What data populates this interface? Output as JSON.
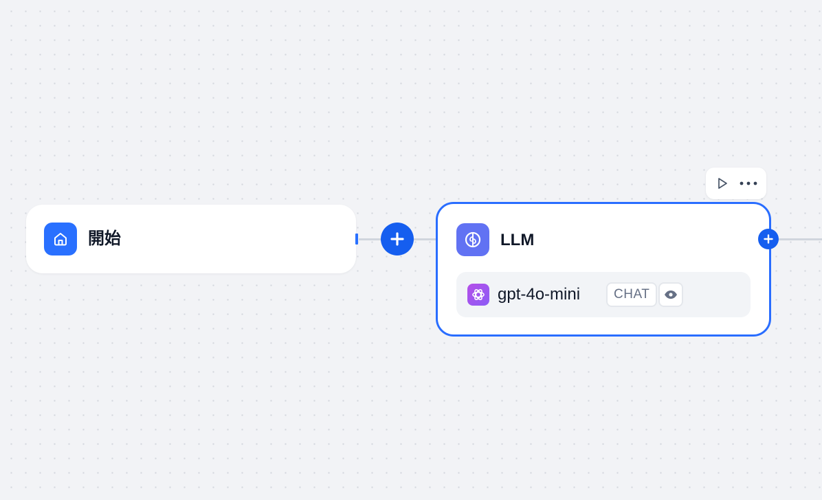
{
  "workflow": {
    "nodes": [
      {
        "id": "start",
        "title": "開始",
        "icon": "home-icon",
        "icon_color": "#2970ff"
      },
      {
        "id": "llm",
        "title": "LLM",
        "icon": "brain-icon",
        "icon_color": "#6172f3",
        "selected": true,
        "model": {
          "name": "gpt-4o-mini",
          "provider_icon": "openai-icon",
          "mode_badge": "CHAT",
          "feature_icon": "eye-icon"
        }
      }
    ],
    "toolbar": {
      "actions": [
        "run-icon",
        "more-icon"
      ]
    },
    "add_buttons": [
      "add-node-button",
      "add-next-node-button"
    ]
  },
  "colors": {
    "accent": "#155eef",
    "selected_border": "#296dff",
    "canvas": "#f2f3f6",
    "edge": "#d0d5dd"
  }
}
